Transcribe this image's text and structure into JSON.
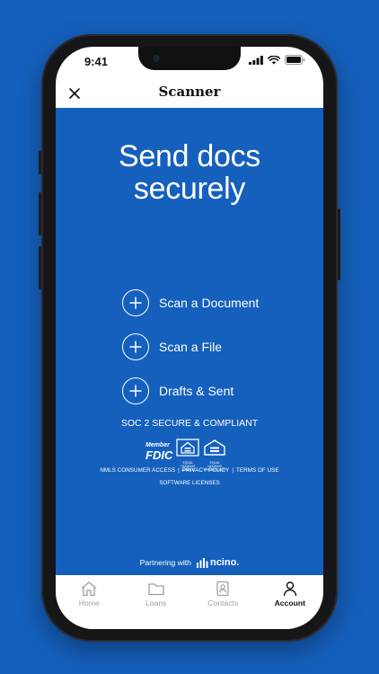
{
  "status_bar": {
    "time": "9:41"
  },
  "header": {
    "title": "Scanner"
  },
  "hero": {
    "line1": "Send docs",
    "line2": "securely"
  },
  "actions": [
    {
      "label": "Scan a Document"
    },
    {
      "label": "Scan a File"
    },
    {
      "label": "Drafts & Sent"
    }
  ],
  "compliance": {
    "soc": "SOC 2 SECURE & COMPLIANT",
    "fdic_member": "Member",
    "fdic_name": "FDIC",
    "lender_caption": "EQUAL HOUSING LENDER",
    "opportunity_caption": "EQUAL HOUSING OPPORTUNITY"
  },
  "links": {
    "nmls": "NMLS CONSUMER ACCESS",
    "privacy": "PRIVACY POLICY",
    "terms": "TERMS OF USE",
    "separator": "|",
    "licenses": "SOFTWARE LICENSES"
  },
  "partner": {
    "text": "Partnering with",
    "brand": "ncino."
  },
  "tabs": [
    {
      "label": "Home",
      "icon": "home-icon",
      "active": false
    },
    {
      "label": "Loans",
      "icon": "folder-icon",
      "active": false
    },
    {
      "label": "Contacts",
      "icon": "contacts-icon",
      "active": false
    },
    {
      "label": "Account",
      "icon": "person-icon",
      "active": true
    }
  ],
  "colors": {
    "brand_blue": "#1560bd",
    "inactive_tab": "#9aa0a6"
  }
}
